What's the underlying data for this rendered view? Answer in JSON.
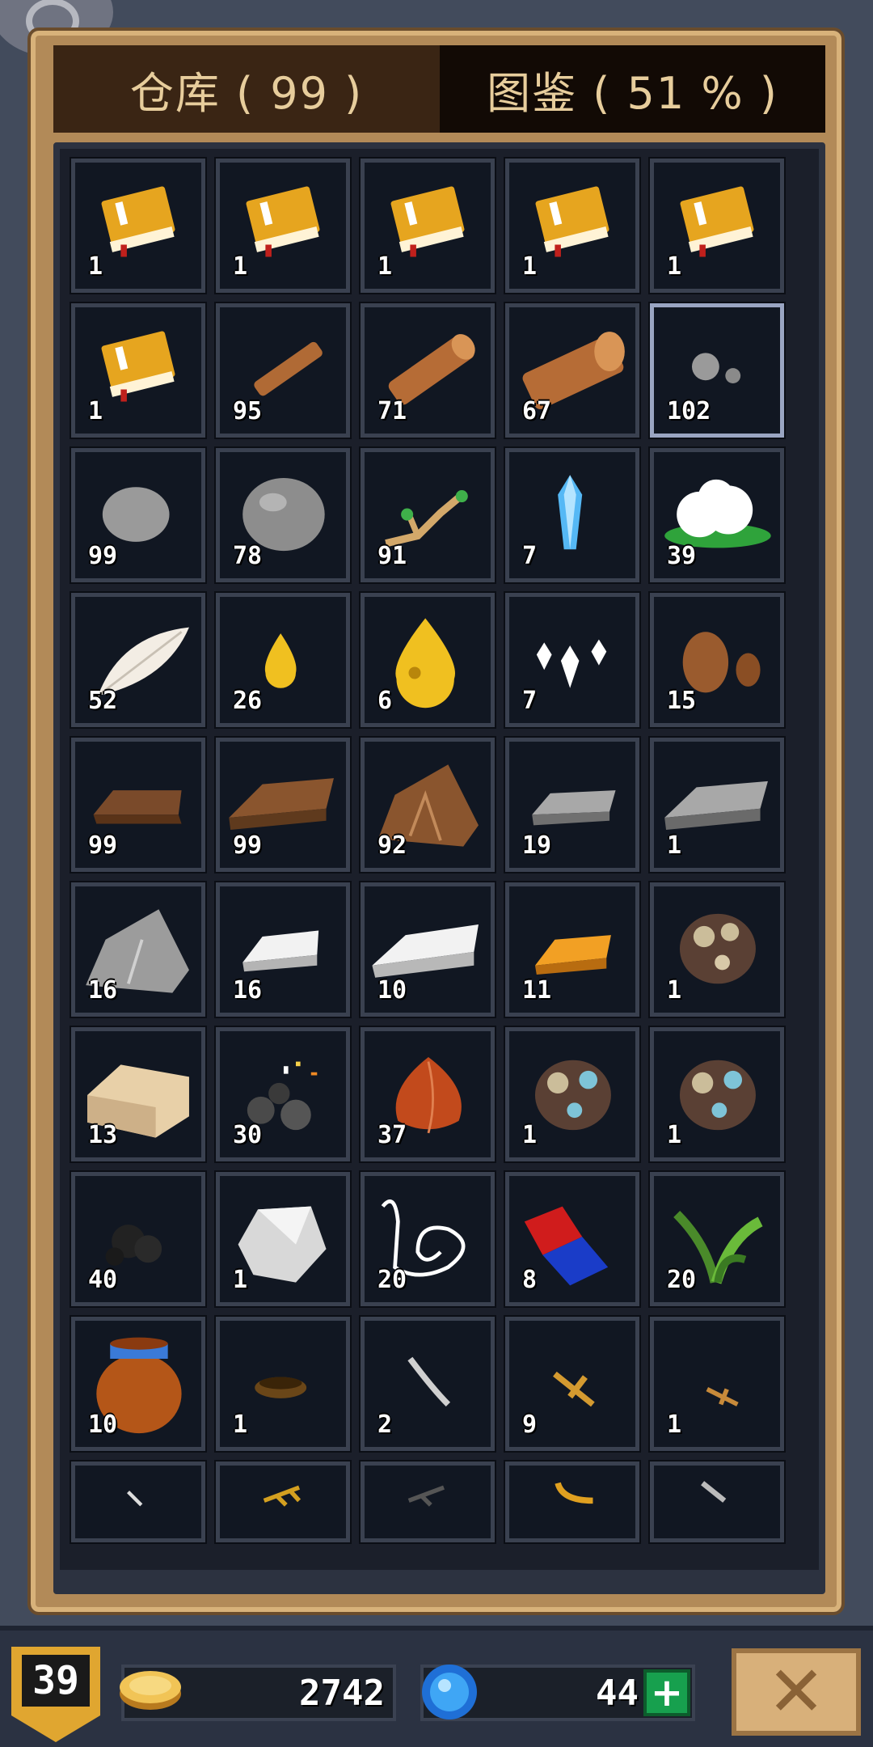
{
  "tabs": {
    "warehouse": "仓库 ( 99 )",
    "codex": "图鉴 ( 51 % )"
  },
  "items": [
    {
      "icon": "book-icon",
      "count": "1"
    },
    {
      "icon": "book-icon",
      "count": "1"
    },
    {
      "icon": "book-icon",
      "count": "1"
    },
    {
      "icon": "book-icon",
      "count": "1"
    },
    {
      "icon": "book-icon",
      "count": "1"
    },
    {
      "icon": "book-icon",
      "count": "1"
    },
    {
      "icon": "wood-stick-icon",
      "count": "95"
    },
    {
      "icon": "wood-log-icon",
      "count": "71"
    },
    {
      "icon": "wood-block-icon",
      "count": "67"
    },
    {
      "icon": "small-stones-icon",
      "count": "102"
    },
    {
      "icon": "stone-icon",
      "count": "99"
    },
    {
      "icon": "big-stone-icon",
      "count": "78"
    },
    {
      "icon": "branch-icon",
      "count": "91"
    },
    {
      "icon": "crystal-icon",
      "count": "7"
    },
    {
      "icon": "cotton-icon",
      "count": "39"
    },
    {
      "icon": "feather-icon",
      "count": "52"
    },
    {
      "icon": "small-oil-drop-icon",
      "count": "26"
    },
    {
      "icon": "big-oil-drop-icon",
      "count": "6"
    },
    {
      "icon": "spikes-icon",
      "count": "7"
    },
    {
      "icon": "clay-icon",
      "count": "15"
    },
    {
      "icon": "copper-bar-icon",
      "count": "99"
    },
    {
      "icon": "copper-ingot-icon",
      "count": "99"
    },
    {
      "icon": "copper-ore-icon",
      "count": "92"
    },
    {
      "icon": "iron-bar-icon",
      "count": "19"
    },
    {
      "icon": "iron-ingot-icon",
      "count": "1"
    },
    {
      "icon": "iron-ore-icon",
      "count": "16"
    },
    {
      "icon": "silver-bar-icon",
      "count": "16"
    },
    {
      "icon": "silver-ingot-icon",
      "count": "10"
    },
    {
      "icon": "gold-bar-icon",
      "count": "11"
    },
    {
      "icon": "gem-ore-icon",
      "count": "1"
    },
    {
      "icon": "sandstone-block-icon",
      "count": "13"
    },
    {
      "icon": "coal-sparks-icon",
      "count": "30"
    },
    {
      "icon": "onion-icon",
      "count": "37"
    },
    {
      "icon": "gem-ore-blue-icon",
      "count": "1"
    },
    {
      "icon": "gem-ore-blue-icon",
      "count": "1"
    },
    {
      "icon": "charcoal-icon",
      "count": "40"
    },
    {
      "icon": "quartz-icon",
      "count": "1"
    },
    {
      "icon": "rope-icon",
      "count": "20"
    },
    {
      "icon": "magnet-icon",
      "count": "8"
    },
    {
      "icon": "herb-icon",
      "count": "20"
    },
    {
      "icon": "jar-icon",
      "count": "10"
    },
    {
      "icon": "bowl-icon",
      "count": "1"
    },
    {
      "icon": "tooth-icon",
      "count": "2"
    },
    {
      "icon": "twig-icon",
      "count": "9"
    },
    {
      "icon": "small-twig-icon",
      "count": "1"
    },
    {
      "icon": "bone-icon",
      "count": ""
    },
    {
      "icon": "golden-branch-icon",
      "count": ""
    },
    {
      "icon": "dark-branch-icon",
      "count": ""
    },
    {
      "icon": "boomerang-icon",
      "count": ""
    },
    {
      "icon": "blade-icon",
      "count": ""
    }
  ],
  "bottom_bar": {
    "level": "39",
    "coins": "2742",
    "gems": "44",
    "add_label": "+",
    "close_label": "✕"
  },
  "colors": {
    "frame": "#b28a58",
    "tab_active": "#3a2514",
    "tab_inactive": "#120a05",
    "tab_text": "#e7cd9c",
    "slot_bg": "#111722",
    "slot_border": "#3a4150"
  }
}
